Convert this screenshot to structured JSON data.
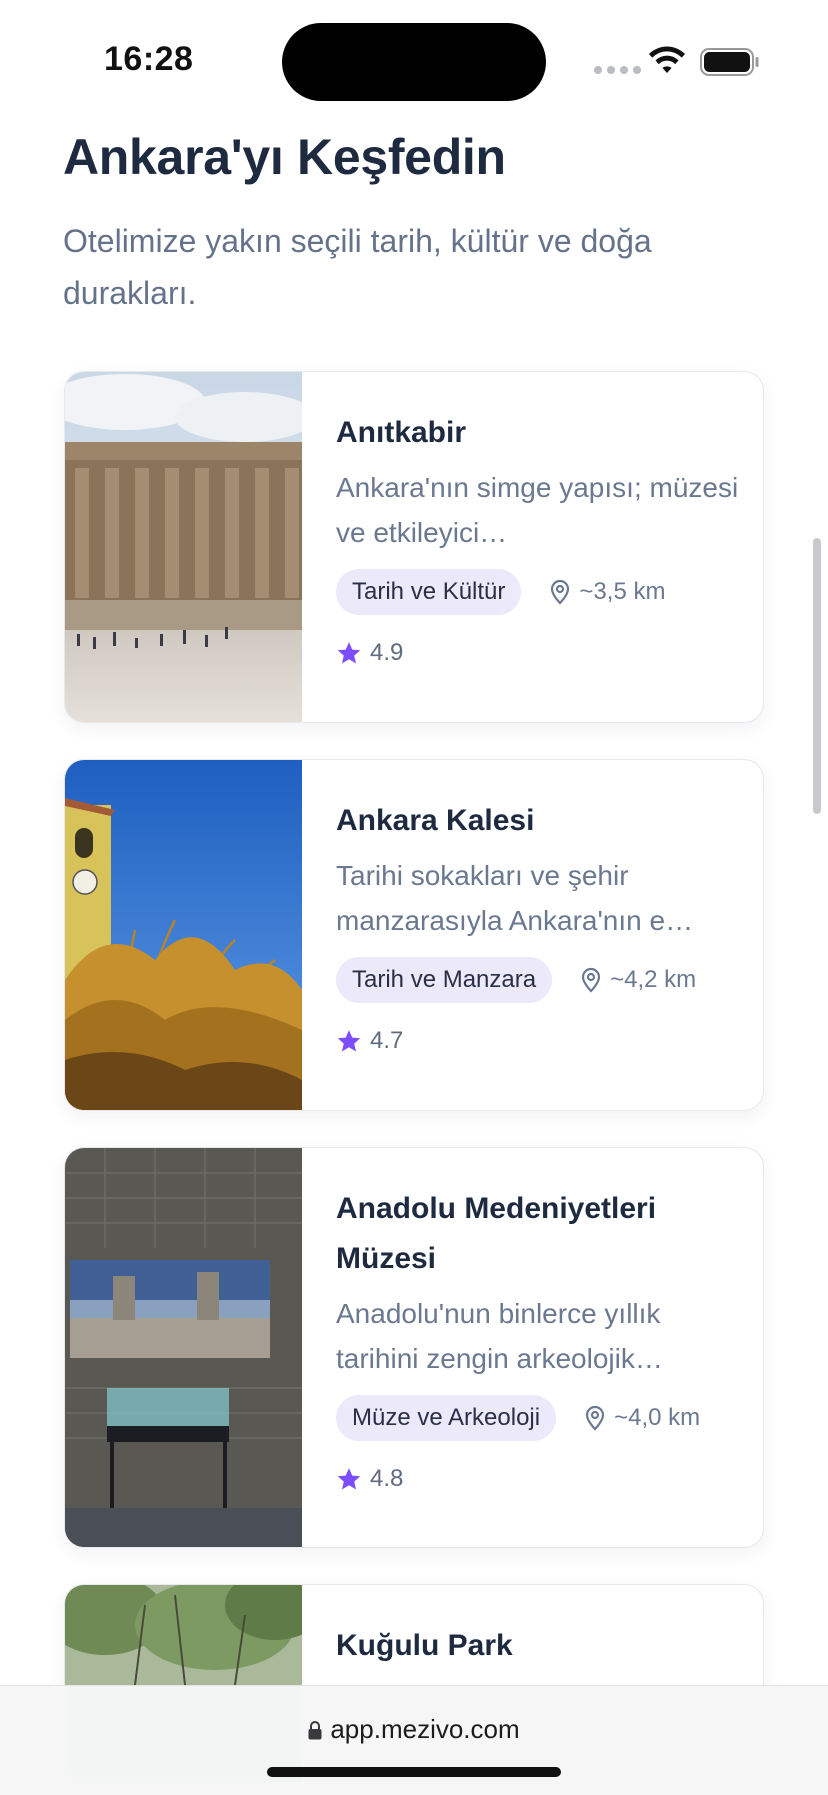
{
  "status": {
    "time": "16:28"
  },
  "header": {
    "title": "Ankara'yı Keşfedin",
    "subtitle": "Otelimize yakın seçili tarih, kültür ve doğa durakları."
  },
  "places": [
    {
      "title": "Anıtkabir",
      "desc": "Ankara'nın simge yapısı; müzesi ve etkileyici…",
      "tag": "Tarih ve Kültür",
      "distance": "~3,5 km",
      "rating": "4.9"
    },
    {
      "title": "Ankara Kalesi",
      "desc": "Tarihi sokakları ve şehir manzarasıyla Ankara'nın e…",
      "tag": "Tarih ve Manzara",
      "distance": "~4,2 km",
      "rating": "4.7"
    },
    {
      "title": "Anadolu Medeniyetleri Müzesi",
      "desc": "Anadolu'nun binlerce yıllık tarihini zengin arkeolojik…",
      "tag": "Müze ve Arkeoloji",
      "distance": "~4,0 km",
      "rating": "4.8"
    },
    {
      "title": "Kuğulu Park"
    }
  ],
  "browser": {
    "url": "app.mezivo.com"
  },
  "colors": {
    "accent": "#7c4dff",
    "tag_bg": "#ece9fb",
    "title": "#1d2a40",
    "muted": "#6a7890"
  },
  "icons": [
    "wifi-icon",
    "battery-icon",
    "location-pin-icon",
    "star-icon",
    "lock-icon"
  ]
}
